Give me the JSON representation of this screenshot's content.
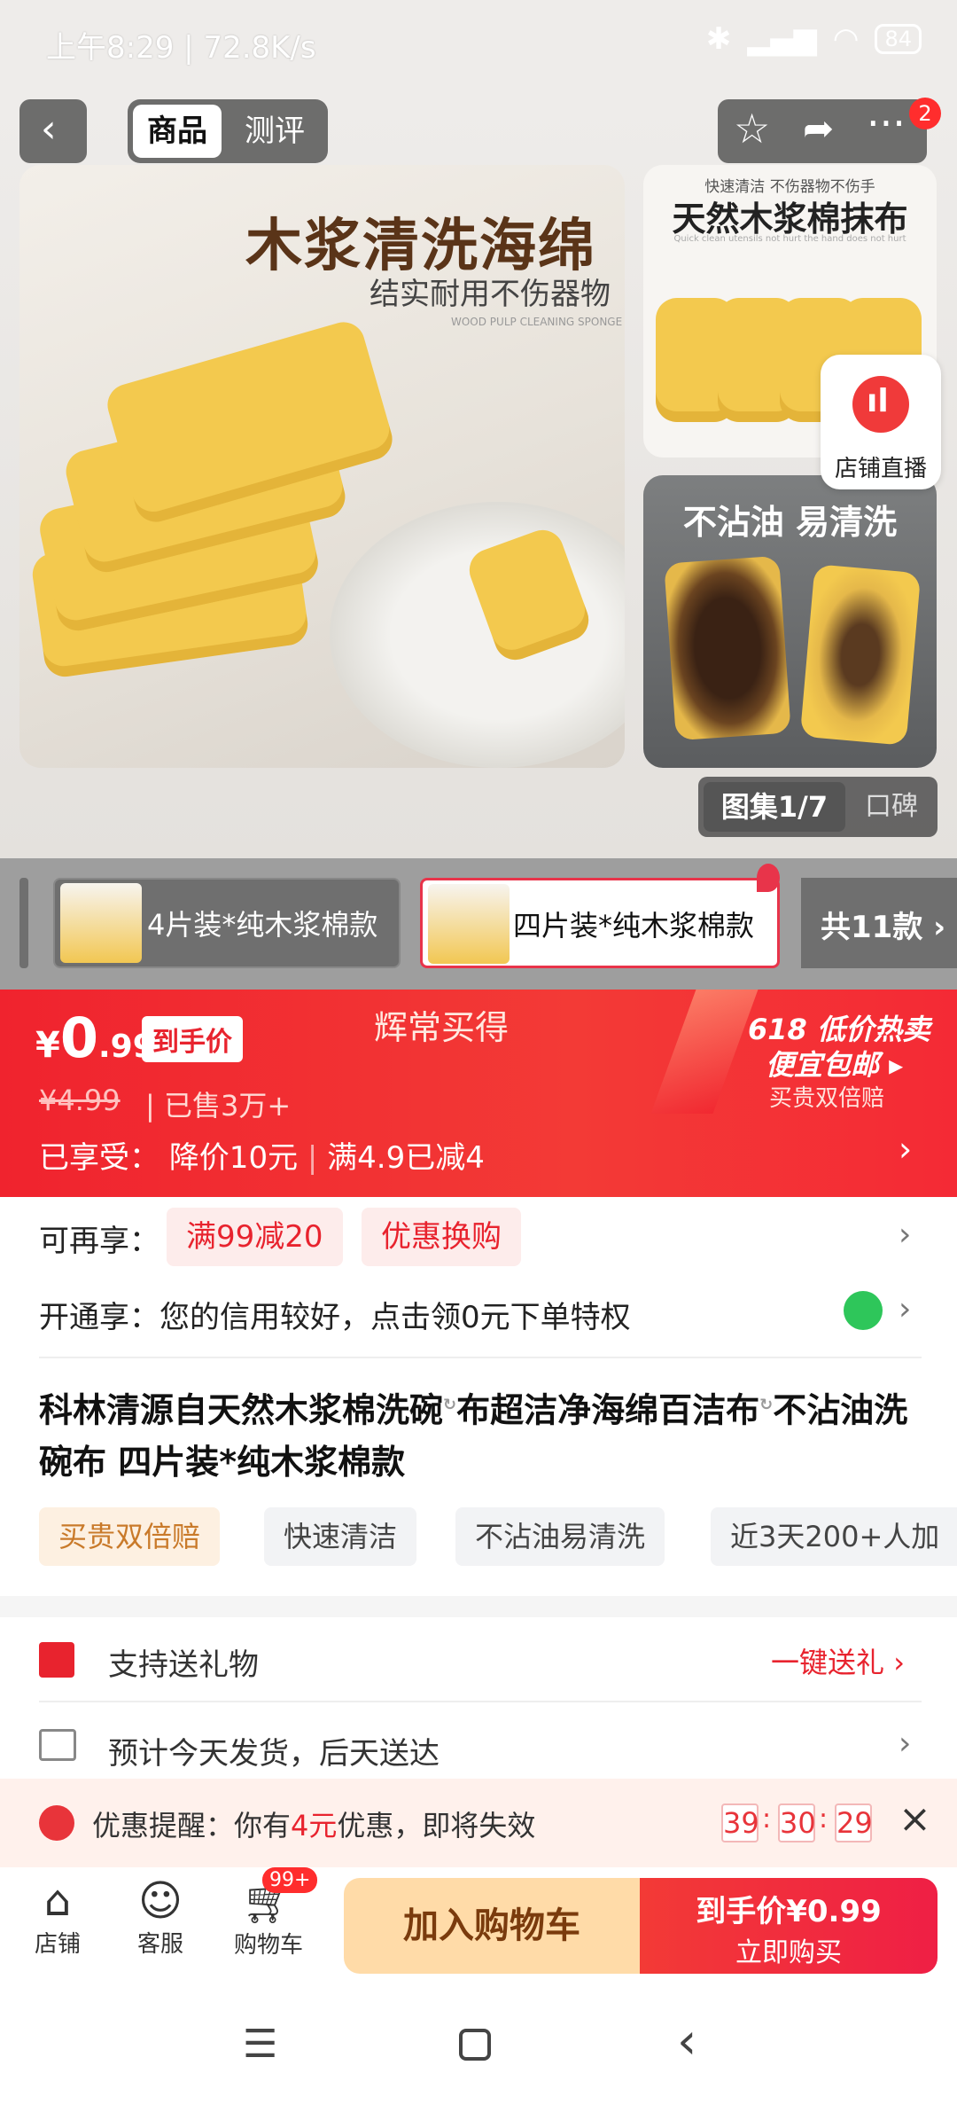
{
  "status_bar": {
    "time": "上午8:29",
    "speed": "72.8K/s",
    "battery": "84"
  },
  "header": {
    "tabs": [
      "商品",
      "测评"
    ],
    "cart_badge": "2"
  },
  "images": {
    "main_title": "木浆清洗海绵",
    "main_subtitle": "结实耐用不伤器物",
    "main_english": "WOOD PULP CLEANING SPONGE",
    "thumb1_small": "快速清洁 不伤器物不伤手",
    "thumb1_title": "天然木浆棉抹布",
    "thumb1_english": "Quick clean utensils not hurt the hand does not hurt",
    "thumb2_title": "不沾油 易清洗",
    "live_label": "店铺直播",
    "gallery_label": "图集1/7",
    "reviews_label": "口碑"
  },
  "variants": {
    "items": [
      "4片装*纯木浆棉款",
      "四片装*纯木浆棉款"
    ],
    "total": "共11款"
  },
  "price_banner": {
    "currency": "¥",
    "price_int": "0",
    "price_dec": ".99",
    "tag": "到手价",
    "brand": "辉常买得",
    "original": "¥4.99",
    "sold": "已售3万+",
    "promo_title": "618 低价热卖",
    "promo_sub": "便宜包邮",
    "promo_note": "买贵双倍赔",
    "enjoyed_label": "已享受：",
    "enjoyed_1": "降价10元",
    "enjoyed_2": "满4.9已减4"
  },
  "offers": {
    "more_label": "可再享：",
    "chips": [
      "满99减20",
      "优惠换购"
    ],
    "credit_label": "开通享：",
    "credit_text": "您的信用较好，点击领0元下单特权"
  },
  "product": {
    "title_1": "科林清源自天然木浆棉洗碗",
    "title_2": "布超洁净海绵百洁布",
    "title_3": "不沾油洗碗布 四片装*纯木浆棉款",
    "tags": [
      "买贵双倍赔",
      "快速清洁",
      "不沾油易清洗",
      "近3天200+人加"
    ]
  },
  "services": {
    "gift": "支持送礼物",
    "gift_action": "一键送礼",
    "delivery": "预计今天发货，后天送达"
  },
  "reminder": {
    "prefix": "优惠提醒：你有",
    "amount": "4元",
    "suffix": "优惠，即将失效",
    "h": "39",
    "m": "30",
    "s": "29"
  },
  "bottom": {
    "shop": "店铺",
    "service": "客服",
    "cart": "购物车",
    "cart_badge": "99+",
    "add_cart": "加入购物车",
    "buy_label": "到手价",
    "buy_price": "¥0.99",
    "buy_now": "立即购买"
  },
  "colors": {
    "accent": "#f0232e",
    "cart_button": "#ffd9a6"
  }
}
